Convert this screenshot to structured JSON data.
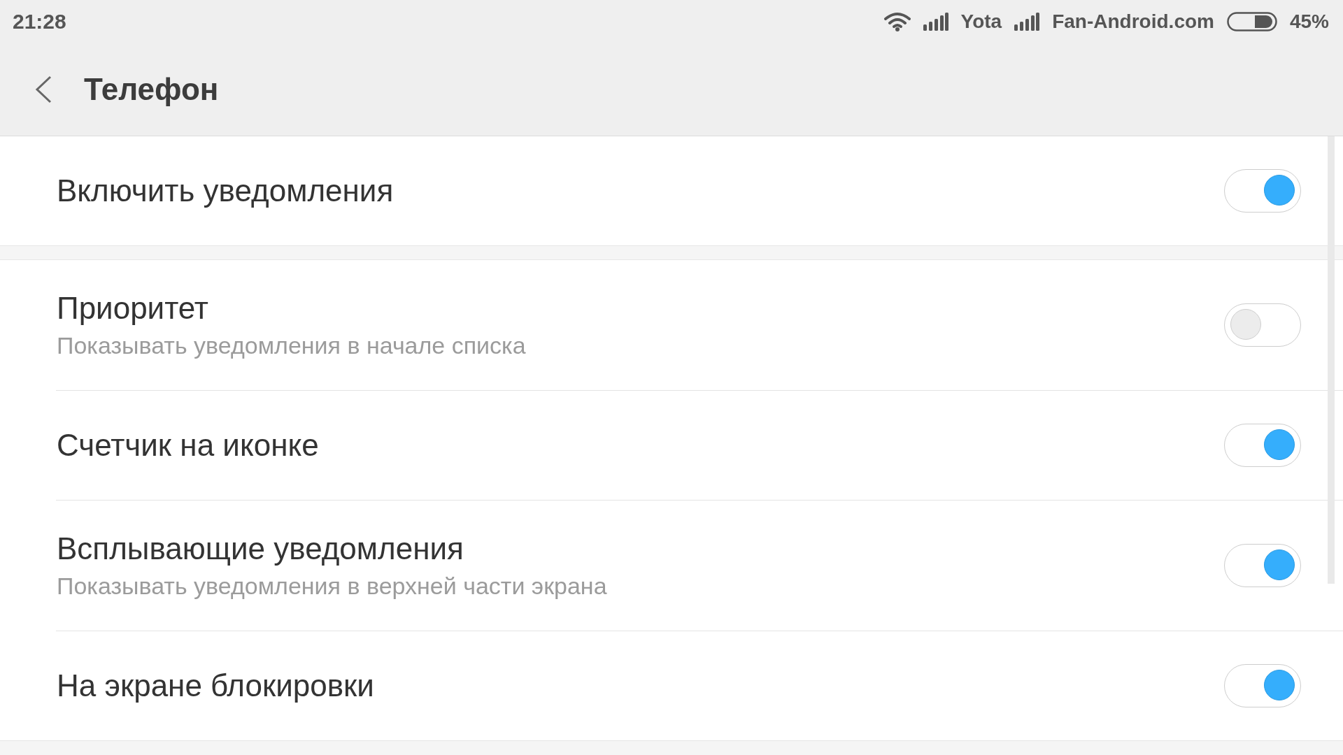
{
  "status_bar": {
    "time": "21:28",
    "carriers": [
      {
        "name": "Yota"
      },
      {
        "name": "Fan-Android.com"
      }
    ],
    "battery_text": "45%"
  },
  "header": {
    "title": "Телефон"
  },
  "groups": [
    {
      "items": [
        {
          "title": "Включить уведомления",
          "on": true
        }
      ]
    },
    {
      "items": [
        {
          "title": "Приоритет",
          "subtitle": "Показывать уведомления в начале списка",
          "on": false
        },
        {
          "title": "Счетчик на иконке",
          "on": true
        },
        {
          "title": "Всплывающие уведомления",
          "subtitle": "Показывать уведомления в верхней части экрана",
          "on": true
        },
        {
          "title": "На экране блокировки",
          "on": true
        }
      ]
    }
  ]
}
